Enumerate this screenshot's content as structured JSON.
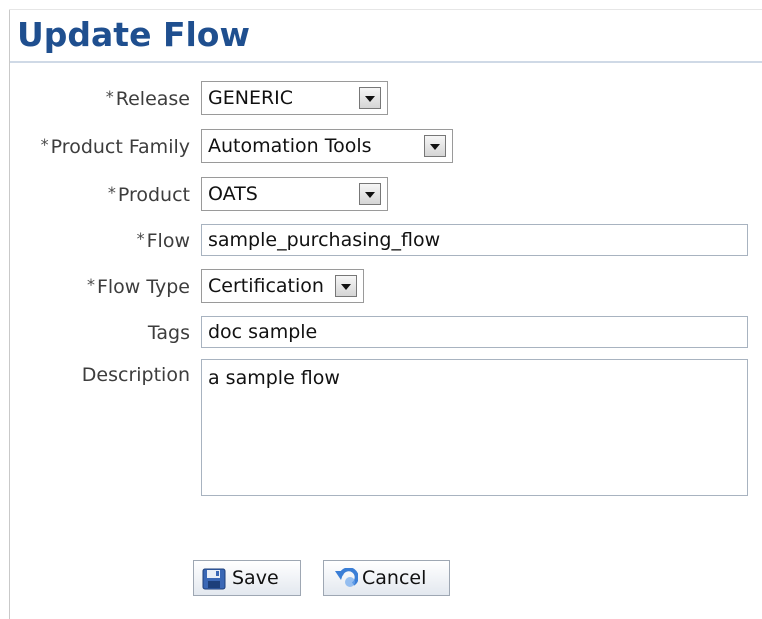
{
  "page": {
    "title": "Update Flow"
  },
  "form": {
    "release": {
      "label": "Release",
      "required": "*",
      "value": "GENERIC"
    },
    "product_family": {
      "label": "Product Family",
      "required": "*",
      "value": "Automation Tools"
    },
    "product": {
      "label": "Product",
      "required": "*",
      "value": "OATS"
    },
    "flow": {
      "label": "Flow",
      "required": "*",
      "value": "sample_purchasing_flow"
    },
    "flow_type": {
      "label": "Flow Type",
      "required": "*",
      "value": "Certification"
    },
    "tags": {
      "label": "Tags",
      "value": "doc sample"
    },
    "description": {
      "label": "Description",
      "value": "a sample flow"
    }
  },
  "buttons": {
    "save": "Save",
    "cancel": "Cancel"
  },
  "colors": {
    "title": "#1f4f8f",
    "label": "#3d3d3d"
  },
  "icons": {
    "save": "floppy-disk-icon",
    "cancel": "undo-arrow-icon",
    "dropdown": "dropdown-arrow-icon"
  }
}
